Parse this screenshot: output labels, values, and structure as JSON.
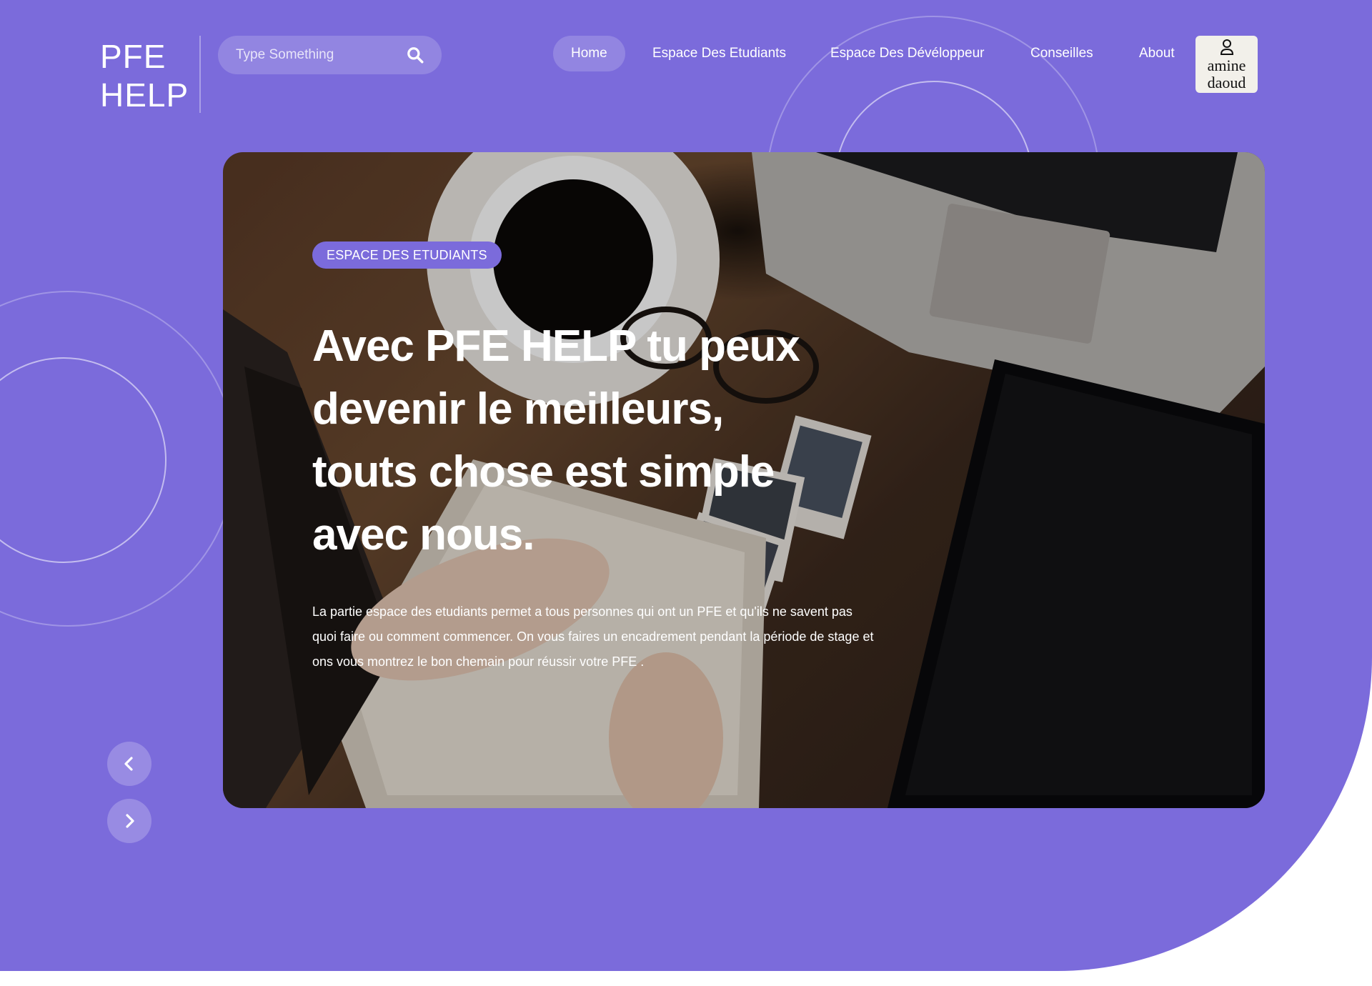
{
  "brand": {
    "line1": "PFE",
    "line2": "HELP"
  },
  "search": {
    "placeholder": "Type Something",
    "icon": "search-icon"
  },
  "nav": {
    "items": [
      {
        "label": "Home",
        "active": true
      },
      {
        "label": "Espace Des Etudiants",
        "active": false
      },
      {
        "label": "Espace Des Dévéloppeur",
        "active": false
      },
      {
        "label": "Conseilles",
        "active": false
      },
      {
        "label": "About",
        "active": false
      }
    ]
  },
  "user": {
    "icon": "user-icon",
    "name_line1": "amine",
    "name_line2": "daoud"
  },
  "slide": {
    "tag": "ESPACE DES ETUDIANTS",
    "headline": "Avec PFE HELP tu peux devenir le meilleurs, touts chose est simple avec nous.",
    "description": "La partie espace des etudiants permet a tous personnes qui ont un PFE et qu'ils ne savent pas quoi faire ou comment commencer. On vous faires un encadrement pendant la période de stage et ons vous montrez le bon chemain pour réussir votre PFE ."
  },
  "carousel": {
    "prev_icon": "chevron-left-icon",
    "next_icon": "chevron-right-icon"
  },
  "colors": {
    "primary": "#7b6bdb",
    "white": "#ffffff"
  }
}
